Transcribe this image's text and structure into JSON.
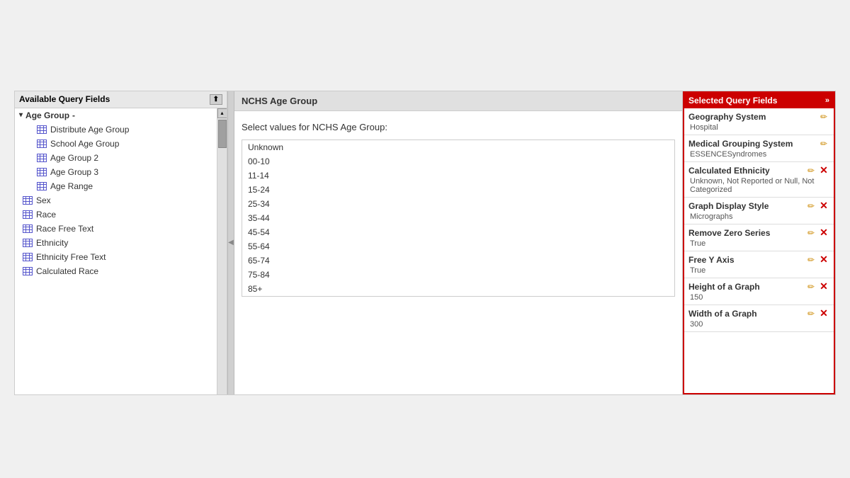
{
  "leftPanel": {
    "header": "Available Query Fields",
    "collapseBtn": "⬆",
    "parentGroup": {
      "label": "Age Group",
      "arrow": "▾",
      "children": [
        "Distribute Age Group",
        "School Age Group",
        "Age Group 2",
        "Age Group 3",
        "Age Range"
      ]
    },
    "topItems": [],
    "bottomItems": [
      "Sex",
      "Race",
      "Race Free Text",
      "Ethnicity",
      "Ethnicity Free Text",
      "Calculated Race"
    ]
  },
  "middlePanel": {
    "title": "NCHS Age Group",
    "selectLabel": "Select values for NCHS Age Group:",
    "values": [
      "Unknown",
      "00-10",
      "11-14",
      "15-24",
      "25-34",
      "35-44",
      "45-54",
      "55-64",
      "65-74",
      "75-84",
      "85+"
    ]
  },
  "rightPanel": {
    "header": "Selected Query Fields",
    "collapseBtn": "»",
    "fields": [
      {
        "name": "Geography System",
        "value": "Hospital",
        "hasEdit": true,
        "hasDelete": false
      },
      {
        "name": "Medical Grouping System",
        "value": "ESSENCESyndromes",
        "hasEdit": true,
        "hasDelete": false
      },
      {
        "name": "Calculated Ethnicity",
        "value": "Unknown, Not Reported or Null, Not Categorized",
        "hasEdit": true,
        "hasDelete": true
      },
      {
        "name": "Graph Display Style",
        "value": "Micrographs",
        "hasEdit": true,
        "hasDelete": true
      },
      {
        "name": "Remove Zero Series",
        "value": "True",
        "hasEdit": true,
        "hasDelete": true
      },
      {
        "name": "Free Y Axis",
        "value": "True",
        "hasEdit": true,
        "hasDelete": true
      },
      {
        "name": "Height of a Graph",
        "value": "150",
        "hasEdit": true,
        "hasDelete": true
      },
      {
        "name": "Width of a Graph",
        "value": "300",
        "hasEdit": true,
        "hasDelete": true
      }
    ]
  },
  "icons": {
    "editIcon": "✏",
    "deleteIcon": "✕",
    "gridIcon": "▦",
    "upArrow": "▴",
    "downArrow": "▾",
    "rightArrow": "▶",
    "collapseDouble": "»"
  }
}
